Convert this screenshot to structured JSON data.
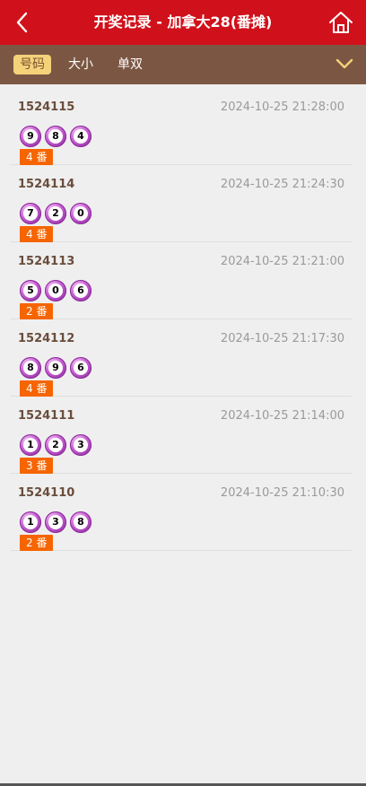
{
  "header": {
    "title": "开奖记录 - 加拿大28(番摊)"
  },
  "tabs": [
    {
      "label": "号码",
      "active": true
    },
    {
      "label": "大小",
      "active": false
    },
    {
      "label": "单双",
      "active": false
    }
  ],
  "records": [
    {
      "issue": "1524115",
      "time": "2024-10-25 21:28:00",
      "balls": [
        "9",
        "8",
        "4"
      ],
      "tag": "4 番"
    },
    {
      "issue": "1524114",
      "time": "2024-10-25 21:24:30",
      "balls": [
        "7",
        "2",
        "0"
      ],
      "tag": "4 番"
    },
    {
      "issue": "1524113",
      "time": "2024-10-25 21:21:00",
      "balls": [
        "5",
        "0",
        "6"
      ],
      "tag": "2 番"
    },
    {
      "issue": "1524112",
      "time": "2024-10-25 21:17:30",
      "balls": [
        "8",
        "9",
        "6"
      ],
      "tag": "4 番"
    },
    {
      "issue": "1524111",
      "time": "2024-10-25 21:14:00",
      "balls": [
        "1",
        "2",
        "3"
      ],
      "tag": "3 番"
    },
    {
      "issue": "1524110",
      "time": "2024-10-25 21:10:30",
      "balls": [
        "1",
        "3",
        "8"
      ],
      "tag": "2 番"
    }
  ],
  "icons": {
    "back": "back-arrow-icon",
    "home": "home-icon",
    "dropdown": "chevron-down-icon"
  },
  "colors": {
    "header_bg": "#d0111b",
    "tabbar_bg": "#7b5743",
    "active_tab_bg": "#f4d27a",
    "tag_bg": "#f66500",
    "ball": "#c75fd3"
  }
}
